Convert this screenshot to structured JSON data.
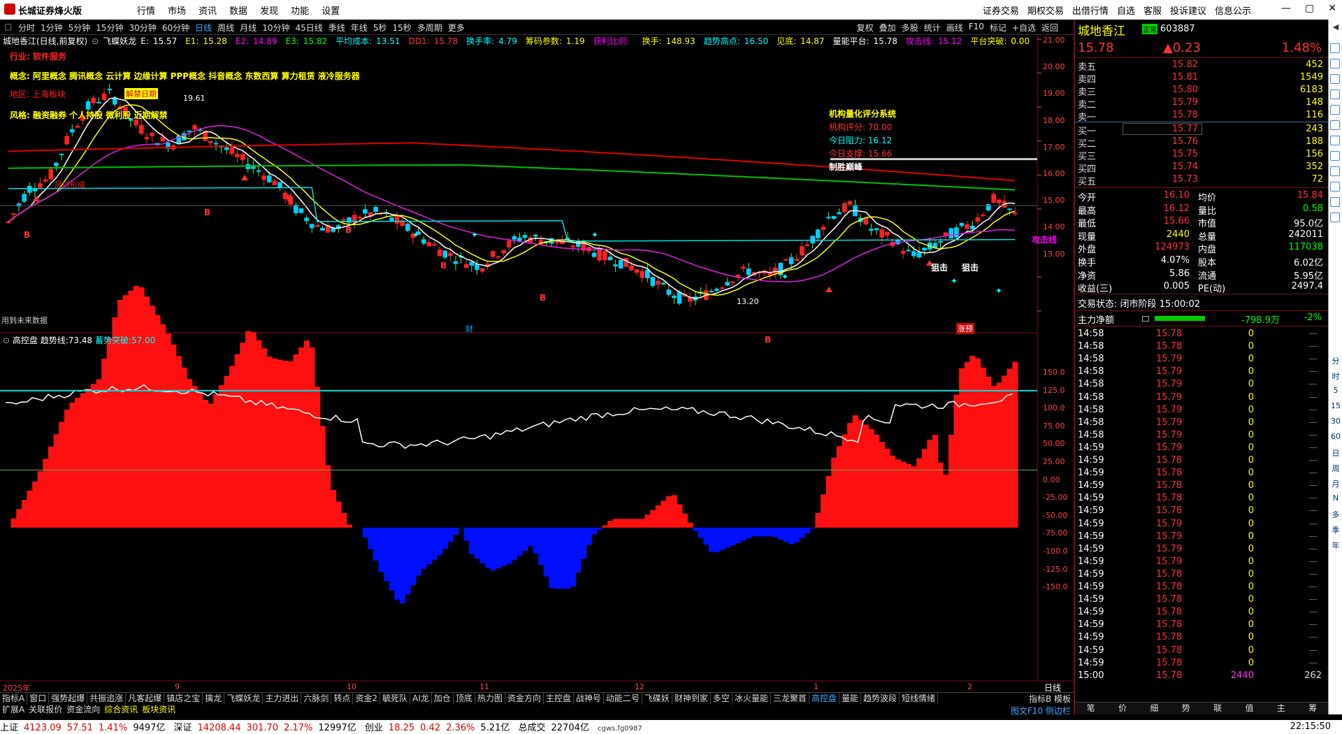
{
  "titlebar": {
    "app_name": "长城证券烽火版",
    "menu": [
      "行情",
      "市场",
      "资讯",
      "数据",
      "发现",
      "功能",
      "设置"
    ],
    "right_menu": [
      "证券交易",
      "期权交易",
      "出借行情",
      "自选",
      "客服",
      "投诉建议",
      "信息公示"
    ]
  },
  "periods": [
    "分时",
    "1分钟",
    "5分钟",
    "15分钟",
    "30分钟",
    "60分钟",
    "日线",
    "周线",
    "月线",
    "10分钟",
    "45日线",
    "季线",
    "年线",
    "5秒",
    "15秒",
    "多周期",
    "更多"
  ],
  "active_period": "日线",
  "tools": [
    "复权",
    "叠加",
    "多股",
    "统计",
    "画线",
    "F10",
    "标记",
    "+自选",
    "返回"
  ],
  "main_info": {
    "title": "城地香江(日线,前复权)",
    "indicator": "飞蝶妖龙",
    "items": [
      {
        "k": "E:",
        "v": "15.57",
        "c": "#fff"
      },
      {
        "k": "E1:",
        "v": "15.28",
        "c": "#ff0"
      },
      {
        "k": "E2:",
        "v": "14.89",
        "c": "#f0f"
      },
      {
        "k": "E3:",
        "v": "15.82",
        "c": "#0f0"
      },
      {
        "k": "平均成本:",
        "v": "13.51",
        "c": "#0ff"
      },
      {
        "k": "DD1:",
        "v": "15.78",
        "c": "#f33"
      },
      {
        "k": "换手率:",
        "v": "4.79",
        "c": "#0ff"
      },
      {
        "k": "筹码参数:",
        "v": "1.19",
        "c": "#ff0"
      },
      {
        "k": "获利比例:",
        "v": "",
        "c": "#f0f"
      },
      {
        "k": "换手:",
        "v": "148.93",
        "c": "#ff0"
      },
      {
        "k": "趋势高点:",
        "v": "16.50",
        "c": "#0ff"
      },
      {
        "k": "见底:",
        "v": "14.87",
        "c": "#ff0"
      },
      {
        "k": "量能平台:",
        "v": "15.78",
        "c": "#fff"
      },
      {
        "k": "攻击线:",
        "v": "15.12",
        "c": "#f0f"
      },
      {
        "k": "平台突破:",
        "v": "0.00",
        "c": "#ff0"
      }
    ]
  },
  "overlay_text": {
    "industry": "行业: 软件服务",
    "concept": "概念: 阿里概念 腾讯概念 云计算 边缘计算 PPP概念 抖音概念 东数西算 算力租赁 液冷服务器",
    "region": "地区: 上海板块",
    "style": "风格: 融资融券 个人持股 微利股 近期解禁",
    "jiejin": "解禁日期",
    "high_label": "19.61",
    "low_label": "13.20",
    "fengkou": "风口形成",
    "future_note": "用到未来数据",
    "cai_label": "财",
    "zhang_label": "涨预",
    "jigou_title": "机构量化评分系统",
    "jigou_score_label": "机构评分:",
    "jigou_score": "70.00",
    "zuli_label": "今日阻力:",
    "zuli": "16.12",
    "zhicheng_label": "今日支撑:",
    "zhicheng": "15.66",
    "zhisheng": "制胜巅峰",
    "gongji": "攻击线",
    "jiji": "狙击"
  },
  "price_axis": [
    "21.00",
    "20.00",
    "19.00",
    "18.00",
    "17.00",
    "16.00",
    "15.00",
    "14.00",
    "13.00"
  ],
  "sub_info": {
    "title": "高控盘",
    "k1": "趋势线:",
    "v1": "73.48",
    "k2": "蓄势突破:",
    "v2": "57.00"
  },
  "sub_axis": [
    "150.0",
    "125.0",
    "100.0",
    "75.00",
    "50.00",
    "25.00",
    "0.00",
    "-25.00",
    "-50.00",
    "-75.00",
    "-100.0",
    "-125.0",
    "-150.0"
  ],
  "date_axis": [
    "2025年",
    "9",
    "10",
    "11",
    "12",
    "1",
    "2"
  ],
  "date_axis_right": "日线",
  "tabs1": [
    "指标A",
    "窗口",
    "强势起爆",
    "共振追涨",
    "凡客起爆",
    "镇店之宝",
    "擒龙",
    "飞蝶妖龙",
    "主力进出",
    "六脉剑",
    "转点",
    "资金2",
    "毓死队",
    "AI龙",
    "加仓",
    "顶底",
    "热力图",
    "资金方向",
    "主控盘",
    "战神号",
    "动能二号",
    "飞碟妖",
    "财神到家",
    "多空",
    "冰火量能",
    "三龙聚首",
    "高控盘",
    "量能",
    "趋势波段",
    "短线情绪"
  ],
  "tabs1_right": "指标B 模板",
  "tabs2": [
    "扩展A",
    "关联报价",
    "资金流向",
    "综合资讯",
    "板块资讯"
  ],
  "tabs2_right": "图文F10 侧边栏",
  "right": {
    "name": "城地香江",
    "code": "603887",
    "price": "15.78",
    "change": "▲0.23",
    "pct": "1.48%",
    "asks": [
      {
        "l": "卖五",
        "p": "15.82",
        "v": "452"
      },
      {
        "l": "卖四",
        "p": "15.81",
        "v": "1549"
      },
      {
        "l": "卖三",
        "p": "15.80",
        "v": "6183"
      },
      {
        "l": "卖二",
        "p": "15.79",
        "v": "148"
      },
      {
        "l": "卖一",
        "p": "15.78",
        "v": "116"
      }
    ],
    "bids": [
      {
        "l": "买一",
        "p": "15.77",
        "v": "243"
      },
      {
        "l": "买二",
        "p": "15.76",
        "v": "188"
      },
      {
        "l": "买三",
        "p": "15.75",
        "v": "156"
      },
      {
        "l": "买四",
        "p": "15.74",
        "v": "352"
      },
      {
        "l": "买五",
        "p": "15.73",
        "v": "72"
      }
    ],
    "stats": [
      {
        "l1": "今开",
        "v1": "16.10",
        "l2": "均价",
        "v2": "15.84",
        "c1": "#f33",
        "c2": "#f33"
      },
      {
        "l1": "最高",
        "v1": "16.12",
        "l2": "量比",
        "v2": "0.58",
        "c1": "#f33",
        "c2": "#0f0"
      },
      {
        "l1": "最低",
        "v1": "15.66",
        "l2": "市值",
        "v2": "95.0亿",
        "c1": "#f33",
        "c2": "#fff"
      },
      {
        "l1": "现量",
        "v1": "2440",
        "l2": "总量",
        "v2": "242011",
        "c1": "#ff0",
        "c2": "#fff"
      },
      {
        "l1": "外盘",
        "v1": "124973",
        "l2": "内盘",
        "v2": "117038",
        "c1": "#f33",
        "c2": "#0f0"
      },
      {
        "l1": "换手",
        "v1": "4.07%",
        "l2": "股本",
        "v2": "6.02亿",
        "c1": "#fff",
        "c2": "#fff"
      },
      {
        "l1": "净资",
        "v1": "5.86",
        "l2": "流通",
        "v2": "5.95亿",
        "c1": "#fff",
        "c2": "#fff"
      },
      {
        "l1": "收益(三)",
        "v1": "0.005",
        "l2": "PE(动)",
        "v2": "2497.4",
        "c1": "#fff",
        "c2": "#fff"
      }
    ],
    "trade_status_label": "交易状态:",
    "trade_status": "闭市阶段 15:00:02",
    "zhuli_label": "主力净额",
    "zhuli_value": "-798.9万",
    "zhuli_pct": "-2%",
    "ticks": [
      {
        "t": "14:58",
        "p": "15.78",
        "v": "0"
      },
      {
        "t": "14:58",
        "p": "15.78",
        "v": "0"
      },
      {
        "t": "14:58",
        "p": "15.79",
        "v": "0"
      },
      {
        "t": "14:58",
        "p": "15.79",
        "v": "0"
      },
      {
        "t": "14:58",
        "p": "15.79",
        "v": "0"
      },
      {
        "t": "14:58",
        "p": "15.79",
        "v": "0"
      },
      {
        "t": "14:58",
        "p": "15.79",
        "v": "0"
      },
      {
        "t": "14:58",
        "p": "15.79",
        "v": "0"
      },
      {
        "t": "14:58",
        "p": "15.79",
        "v": "0"
      },
      {
        "t": "14:59",
        "p": "15.79",
        "v": "0"
      },
      {
        "t": "14:59",
        "p": "15.78",
        "v": "0"
      },
      {
        "t": "14:59",
        "p": "15.78",
        "v": "0"
      },
      {
        "t": "14:59",
        "p": "15.78",
        "v": "0"
      },
      {
        "t": "14:59",
        "p": "15.78",
        "v": "0"
      },
      {
        "t": "14:59",
        "p": "15.78",
        "v": "0"
      },
      {
        "t": "14:59",
        "p": "15.79",
        "v": "0"
      },
      {
        "t": "14:59",
        "p": "15.79",
        "v": "0"
      },
      {
        "t": "14:59",
        "p": "15.79",
        "v": "0"
      },
      {
        "t": "14:59",
        "p": "15.79",
        "v": "0"
      },
      {
        "t": "14:59",
        "p": "15.78",
        "v": "0"
      },
      {
        "t": "14:59",
        "p": "15.78",
        "v": "0"
      },
      {
        "t": "14:59",
        "p": "15.78",
        "v": "0"
      },
      {
        "t": "14:59",
        "p": "15.78",
        "v": "0"
      },
      {
        "t": "14:59",
        "p": "15.78",
        "v": "0"
      },
      {
        "t": "14:59",
        "p": "15.78",
        "v": "0"
      },
      {
        "t": "14:59",
        "p": "15.78",
        "v": "0"
      },
      {
        "t": "14:59",
        "p": "15.78",
        "v": "0"
      },
      {
        "t": "15:00",
        "p": "15.78",
        "v": "2440",
        "n": "262"
      }
    ],
    "tabs": [
      "笔",
      "价",
      "细",
      "势",
      "联",
      "值",
      "主",
      "筹"
    ]
  },
  "sidebar": [
    "分",
    "时",
    "5",
    "15",
    "30",
    "60",
    "日",
    "周",
    "月",
    "N",
    "多",
    "季",
    "年"
  ],
  "statusbar": {
    "sh_label": "上证",
    "sh": "4123.09",
    "sh_chg": "57.51",
    "sh_pct": "1.41%",
    "sh_amt": "9497亿",
    "sz_label": "深证",
    "sz": "14208.44",
    "sz_chg": "301.70",
    "sz_pct": "2.17%",
    "sz_amt": "12997亿",
    "cy_label": "创业",
    "cy": "18.25",
    "cy_chg": "0.42",
    "cy_pct": "2.36%",
    "cy_amt": "5.21亿",
    "total_label": "总成交",
    "total": "22704亿",
    "server": "cgws.fg0987",
    "time": "22:15:50"
  },
  "colors": {
    "up": "#ff2020",
    "down": "#0040ff",
    "ma_red": "#e00000",
    "ma_green": "#00c000",
    "ma_magenta": "#e020e0",
    "ma_yellow": "#ffff00",
    "ma_cyan": "#00e0e0"
  }
}
